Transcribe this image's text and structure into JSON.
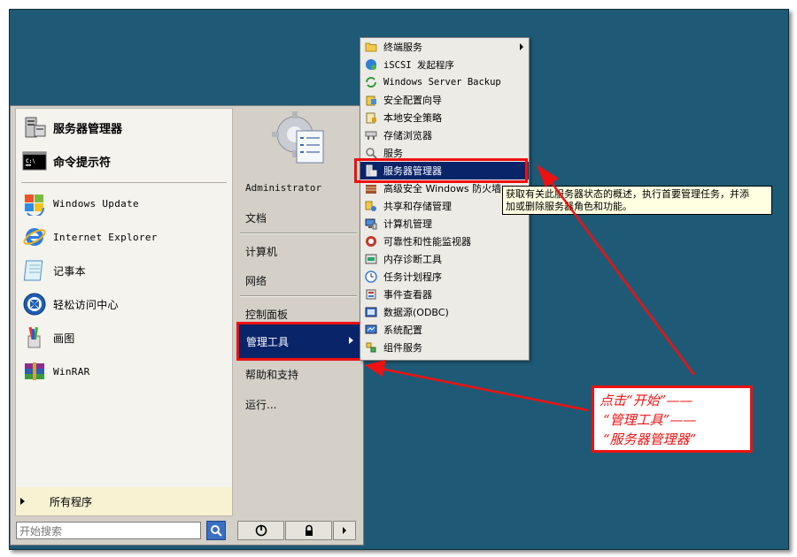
{
  "start_menu": {
    "pinned": [
      {
        "label": "服务器管理器",
        "icon": "server-manager-icon"
      },
      {
        "label": "命令提示符",
        "icon": "command-prompt-icon"
      }
    ],
    "recent": [
      {
        "label": "Windows Update",
        "icon": "windows-update-icon"
      },
      {
        "label": "Internet Explorer",
        "icon": "internet-explorer-icon"
      },
      {
        "label": "记事本",
        "icon": "notepad-icon"
      },
      {
        "label": "轻松访问中心",
        "icon": "ease-of-access-icon"
      },
      {
        "label": "画图",
        "icon": "paint-icon"
      },
      {
        "label": "WinRAR",
        "icon": "winrar-icon"
      }
    ],
    "all_programs": "所有程序",
    "search_placeholder": "开始搜索",
    "right": {
      "user": "Administrator",
      "documents": "文档",
      "computer": "计算机",
      "network": "网络",
      "control_panel": "控制面板",
      "admin_tools": "管理工具",
      "help": "帮助和支持",
      "run": "运行..."
    }
  },
  "submenu": {
    "items": [
      {
        "label": "终端服务",
        "icon": "folder-icon",
        "has_arrow": true
      },
      {
        "label": "iSCSI 发起程序",
        "icon": "iscsi-icon"
      },
      {
        "label": "Windows Server Backup",
        "icon": "backup-icon"
      },
      {
        "label": "安全配置向导",
        "icon": "security-wizard-icon"
      },
      {
        "label": "本地安全策略",
        "icon": "local-security-policy-icon"
      },
      {
        "label": "存储浏览器",
        "icon": "storage-explorer-icon"
      },
      {
        "label": "服务",
        "icon": "services-icon"
      },
      {
        "label": "服务器管理器",
        "icon": "server-manager-icon",
        "selected": true
      },
      {
        "label": "高级安全 Windows 防火墙",
        "icon": "firewall-icon"
      },
      {
        "label": "共享和存储管理",
        "icon": "share-storage-icon"
      },
      {
        "label": "计算机管理",
        "icon": "computer-management-icon"
      },
      {
        "label": "可靠性和性能监视器",
        "icon": "performance-monitor-icon"
      },
      {
        "label": "内存诊断工具",
        "icon": "memory-diagnostic-icon"
      },
      {
        "label": "任务计划程序",
        "icon": "task-scheduler-icon"
      },
      {
        "label": "事件查看器",
        "icon": "event-viewer-icon"
      },
      {
        "label": "数据源(ODBC)",
        "icon": "odbc-icon"
      },
      {
        "label": "系统配置",
        "icon": "system-config-icon"
      },
      {
        "label": "组件服务",
        "icon": "component-services-icon"
      }
    ]
  },
  "tooltip": {
    "line1": "获取有关此服务器状态的概述，执行首要管理任务，并添",
    "line2": "加或删除服务器角色和功能。"
  },
  "callout": {
    "line1": "点击“开始”——",
    "line2": "“管理工具”——",
    "line3": "“服务器管理器”"
  },
  "colors": {
    "desktop": "#1e5a76",
    "highlight": "#0a246a",
    "annotation_red": "#e11111",
    "tooltip_bg": "#ffffe1"
  }
}
